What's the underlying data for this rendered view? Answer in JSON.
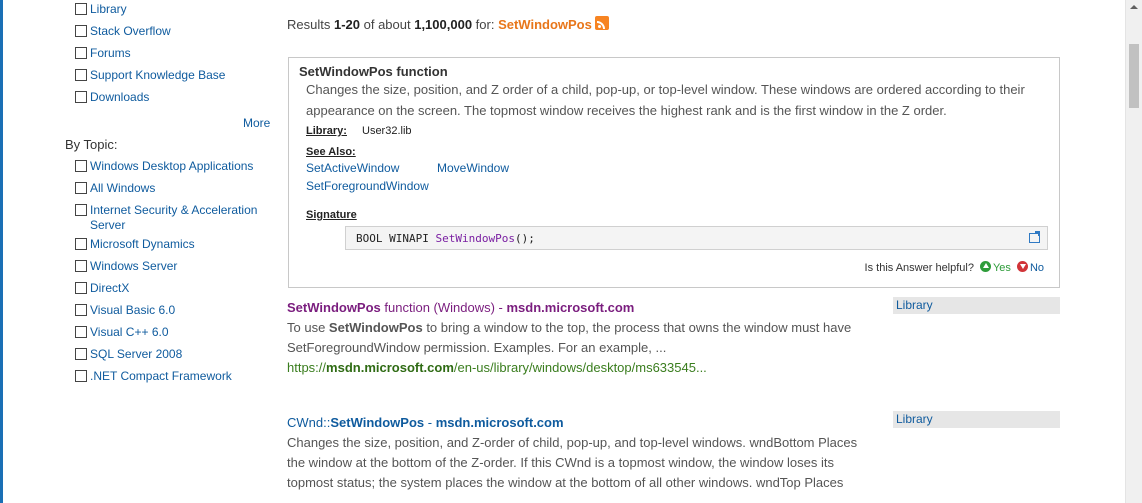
{
  "sidebar": {
    "source_items": [
      {
        "label": "Library"
      },
      {
        "label": "Stack Overflow"
      },
      {
        "label": "Forums"
      },
      {
        "label": "Support Knowledge Base"
      },
      {
        "label": "Downloads"
      }
    ],
    "more_label": "More",
    "by_topic_heading": "By Topic:",
    "topic_items": [
      {
        "label": "Windows Desktop Applications"
      },
      {
        "label": "All Windows"
      },
      {
        "label": "Internet Security & Acceleration"
      },
      {
        "label": "Server"
      },
      {
        "label": "Microsoft Dynamics"
      },
      {
        "label": "Windows Server"
      },
      {
        "label": "DirectX"
      },
      {
        "label": "Visual Basic 6.0"
      },
      {
        "label": "Visual C++ 6.0"
      },
      {
        "label": "SQL Server 2008"
      },
      {
        "label": ".NET Compact Framework"
      }
    ]
  },
  "results_header": {
    "prefix": "Results ",
    "range": "1-20",
    "middle": " of about ",
    "total": "1,100,000",
    "for_label": " for: ",
    "query": "SetWindowPos"
  },
  "answer": {
    "title": "SetWindowPos function",
    "description": "Changes the size, position, and Z order of a child, pop-up, or top-level window. These windows are ordered according to their appearance on the screen. The topmost window receives the highest rank and is the first window in the Z order.",
    "library_label": "Library:",
    "library_value": "User32.lib",
    "see_also_label": "See Also:",
    "see_also_links": [
      "SetActiveWindow",
      "MoveWindow",
      "SetForegroundWindow"
    ],
    "signature_label": "Signature",
    "code_prefix": "BOOL WINAPI ",
    "code_function": "SetWindowPos",
    "code_suffix": "();",
    "helpful_question": "Is this Answer helpful?",
    "yes_label": "Yes",
    "no_label": "No"
  },
  "results": [
    {
      "title_keyword": "SetWindowPos",
      "title_rest": " function (Windows) - ",
      "title_domain": "msdn.microsoft.com",
      "desc_pre": "To use ",
      "desc_keyword": "SetWindowPos",
      "desc_post": " to bring a window to the top, the process that owns the window must have SetForegroundWindow permission. Examples. For an example, ...",
      "url_prefix": "https://",
      "url_domain": "msdn.microsoft.com",
      "url_path": "/en-us/library/windows/desktop/ms633545...",
      "tag": "Library"
    },
    {
      "title_prefix": "CWnd::",
      "title_keyword": "SetWindowPos",
      "title_rest": " - ",
      "title_domain": "msdn.microsoft.com",
      "desc": "Changes the size, position, and Z-order of child, pop-up, and top-level windows. wndBottom Places the window at the bottom of the Z-order. If this CWnd is a topmost window, the window loses its topmost status; the system places the window at the bottom of all other windows. wndTop Places",
      "tag": "Library"
    }
  ],
  "colors": {
    "link": "#0f5b9e",
    "visited": "#7a1d7e",
    "query": "#e8761a",
    "url": "#3a7d1e"
  }
}
